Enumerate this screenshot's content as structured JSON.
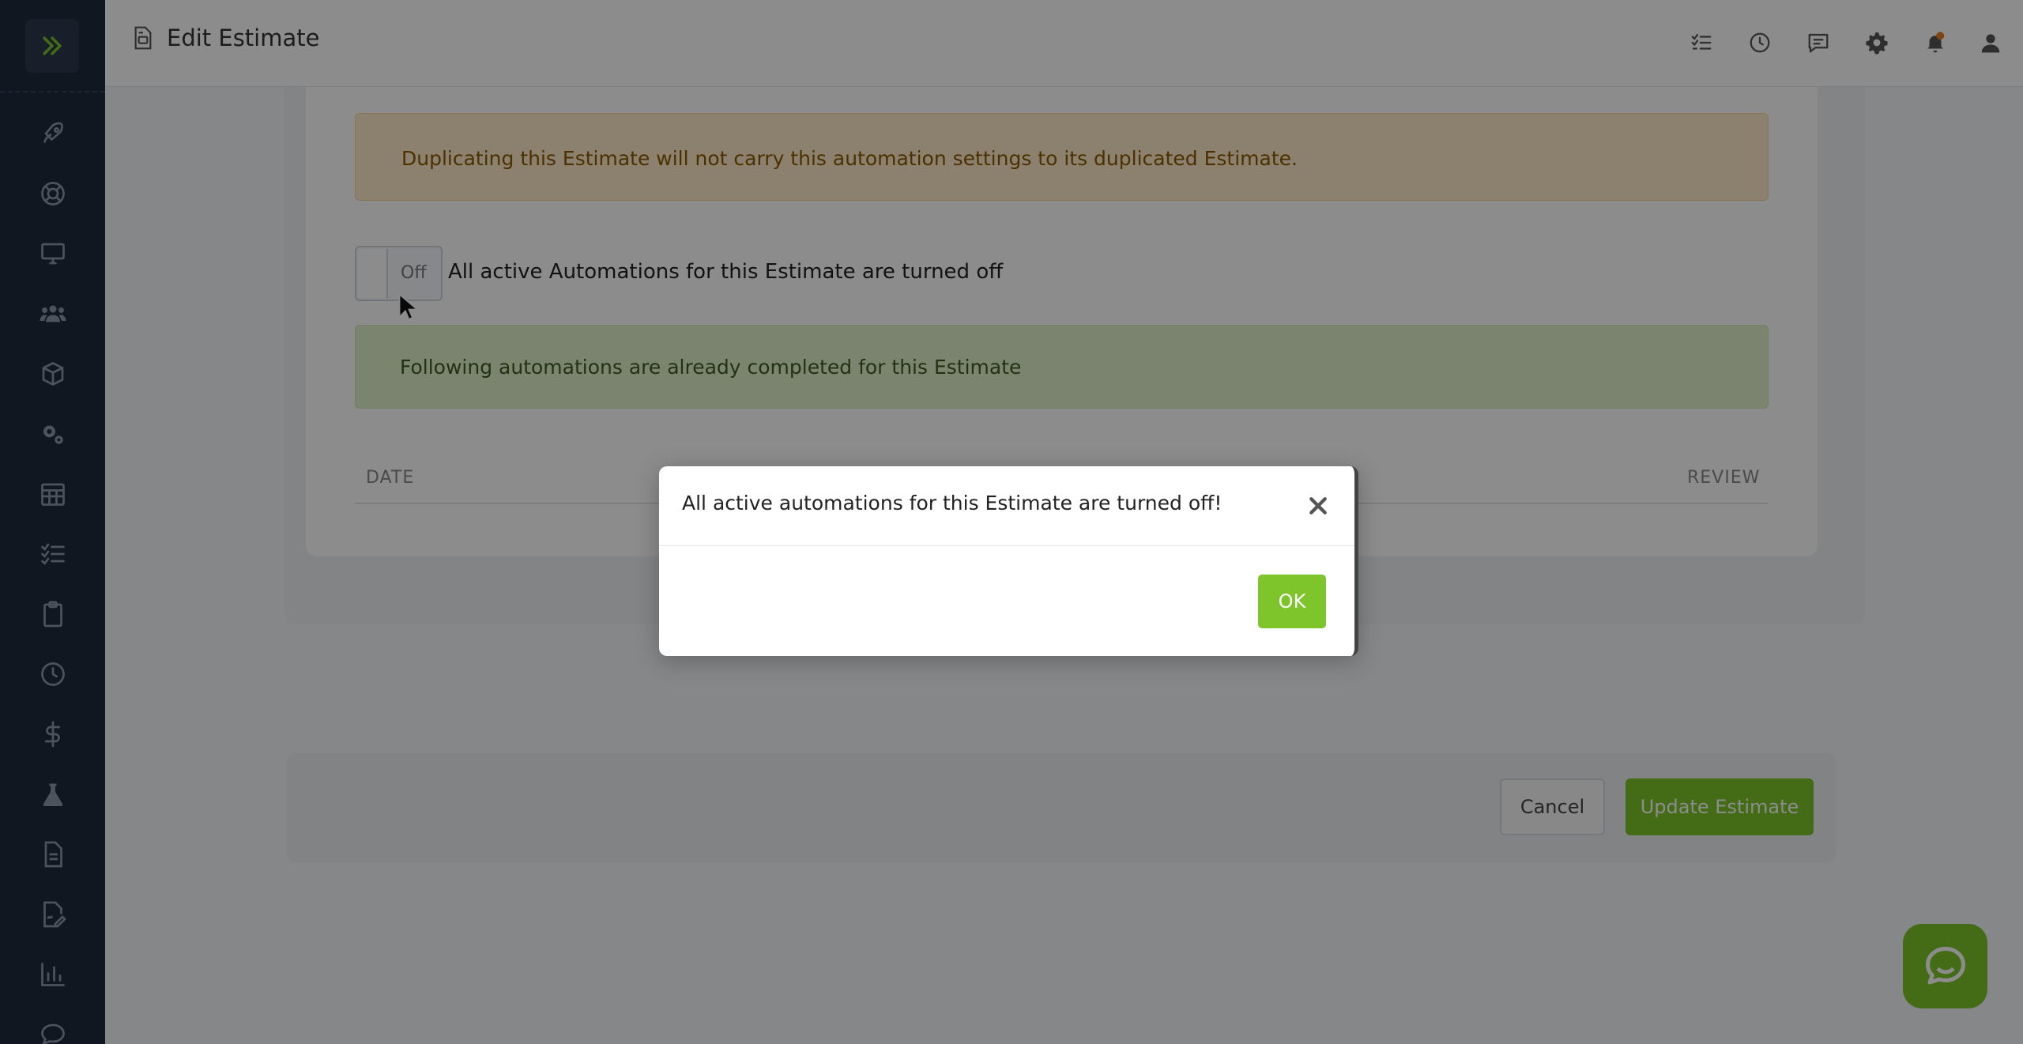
{
  "header": {
    "title": "Edit Estimate",
    "icons": [
      "checklist-icon",
      "clock-icon",
      "message-icon",
      "gear-icon",
      "bell-icon",
      "user-icon"
    ]
  },
  "sidebar": {
    "items": [
      "rocket-icon",
      "lifebuoy-icon",
      "monitor-icon",
      "users-icon",
      "box-icon",
      "gears-icon",
      "calendar-grid-icon",
      "checklist-icon",
      "clipboard-icon",
      "clock-icon",
      "dollar-icon",
      "flask-icon",
      "document-icon",
      "signature-icon",
      "bar-chart-icon",
      "chat-icon"
    ]
  },
  "content": {
    "warning_text": "Duplicating this Estimate will not carry this automation settings to its duplicated Estimate.",
    "toggle_state": "Off",
    "toggle_label": "All active Automations for this Estimate are turned off",
    "success_text": "Following automations are already completed for this Estimate",
    "table_headers": [
      "DATE",
      "REVIEW"
    ]
  },
  "footer": {
    "cancel_label": "Cancel",
    "update_label": "Update Estimate"
  },
  "modal": {
    "title": "All active automations for this Estimate are turned off!",
    "ok_label": "OK"
  },
  "colors": {
    "accent": "#7dc52a",
    "sidebar_bg": "#1e2a3b",
    "warning_bg": "#fdebc8",
    "success_bg": "#dff1c9"
  }
}
